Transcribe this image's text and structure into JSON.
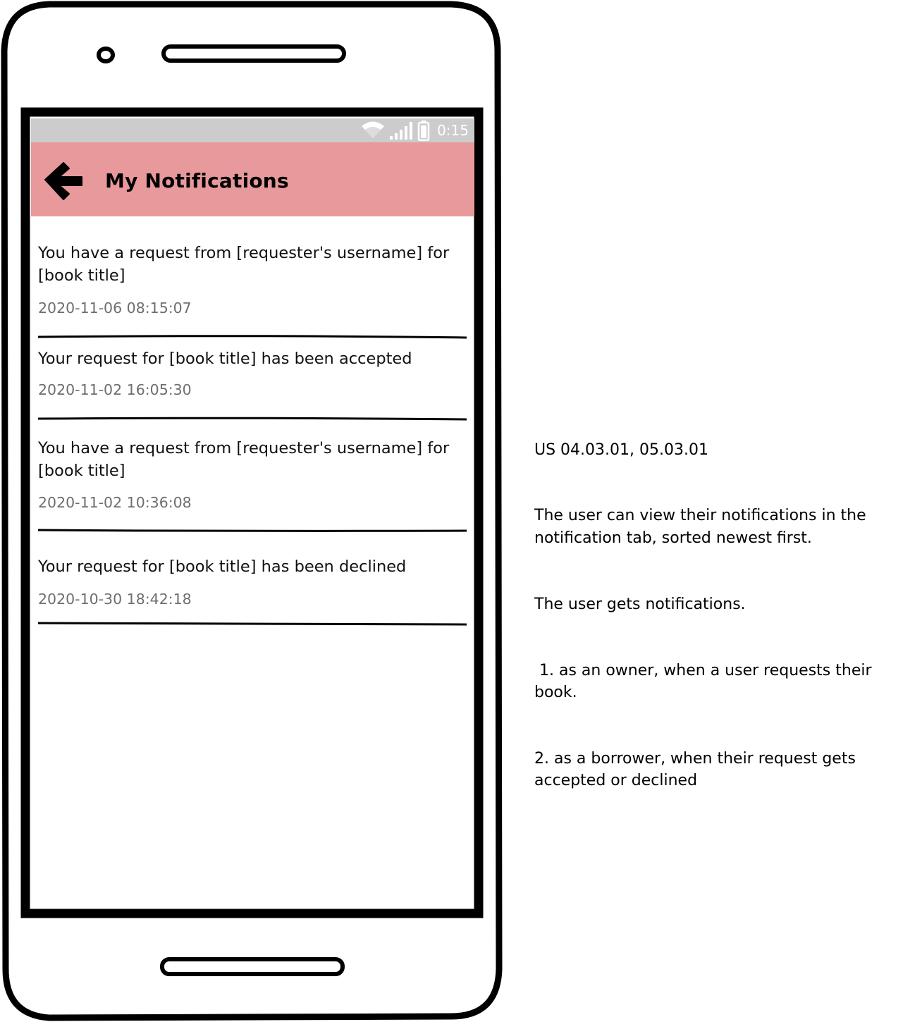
{
  "status_bar": {
    "time": "0:15",
    "icons": [
      "wifi-icon",
      "signal-icon",
      "battery-icon"
    ]
  },
  "app_bar": {
    "title": "My Notifications",
    "back_icon": "arrow-left-icon",
    "background_color": "#e8999b"
  },
  "notifications": [
    {
      "message": "You have a request from [requester's username] for [book title]",
      "timestamp": "2020-11-06 08:15:07"
    },
    {
      "message": "Your request for [book title] has been accepted",
      "timestamp": "2020-11-02 16:05:30"
    },
    {
      "message": "You have a request from [requester's username] for [book title]",
      "timestamp": "2020-11-02 10:36:08"
    },
    {
      "message": "Your request for [book title] has been declined",
      "timestamp": "2020-10-30 18:42:18"
    }
  ],
  "side_note": {
    "lines": [
      "US 04.03.01, 05.03.01",
      "The user can view their notifications in the notification tab, sorted newest first.",
      "The user gets notifications.",
      " 1. as an owner, when a user requests their book.",
      "2. as a borrower, when their request gets accepted or declined"
    ]
  }
}
